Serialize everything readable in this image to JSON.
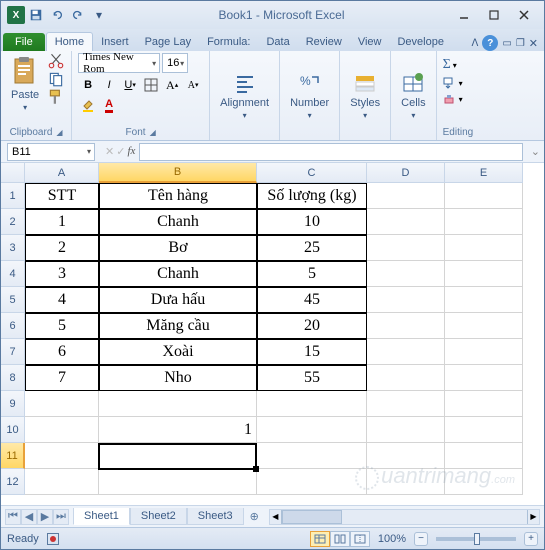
{
  "title": "Book1 - Microsoft Excel",
  "qat": {
    "excel_logo": "X"
  },
  "tabs": {
    "file": "File",
    "items": [
      "Home",
      "Insert",
      "Page Lay",
      "Formula:",
      "Data",
      "Review",
      "View",
      "Develope"
    ],
    "active": 0
  },
  "ribbon": {
    "clipboard": {
      "paste": "Paste",
      "label": "Clipboard"
    },
    "font": {
      "name": "Times New Rom",
      "size": "16",
      "label": "Font"
    },
    "alignment": {
      "btn": "Alignment"
    },
    "number": {
      "btn": "Number"
    },
    "styles": {
      "btn": "Styles"
    },
    "cells": {
      "btn": "Cells"
    },
    "editing": {
      "label": "Editing"
    }
  },
  "namebox": "B11",
  "fx": "fx",
  "columns": [
    "A",
    "B",
    "C",
    "D",
    "E"
  ],
  "rows": [
    "1",
    "2",
    "3",
    "4",
    "5",
    "6",
    "7",
    "8",
    "9",
    "10",
    "11",
    "12"
  ],
  "table": {
    "headers": [
      "STT",
      "Tên hàng",
      "Số lượng (kg)"
    ],
    "data": [
      [
        "1",
        "Chanh",
        "10"
      ],
      [
        "2",
        "Bơ",
        "25"
      ],
      [
        "3",
        "Chanh",
        "5"
      ],
      [
        "4",
        "Dưa hấu",
        "45"
      ],
      [
        "5",
        "Măng cầu",
        "20"
      ],
      [
        "6",
        "Xoài",
        "15"
      ],
      [
        "7",
        "Nho",
        "55"
      ]
    ]
  },
  "b10": "1",
  "sheets": {
    "items": [
      "Sheet1",
      "Sheet2",
      "Sheet3"
    ],
    "active": 0
  },
  "status": {
    "ready": "Ready",
    "zoom": "100%"
  },
  "watermark": "uantrimang"
}
